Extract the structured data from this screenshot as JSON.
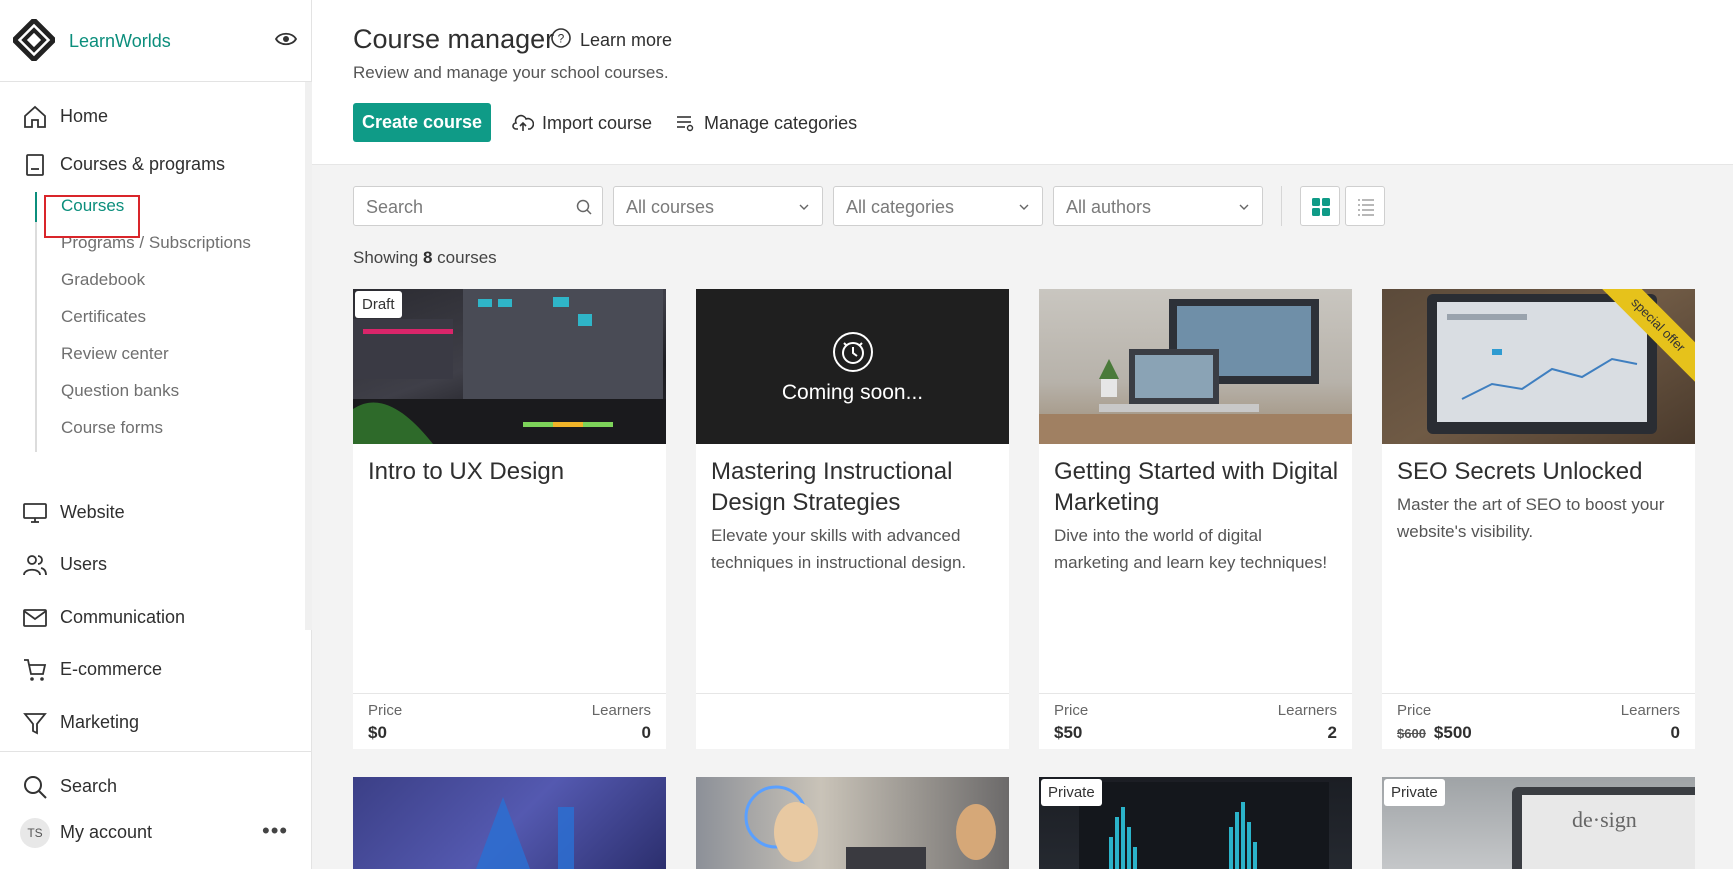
{
  "sidebar": {
    "brand": "LearnWorlds",
    "items": [
      {
        "label": "Home"
      },
      {
        "label": "Courses & programs"
      },
      {
        "label": "Website"
      },
      {
        "label": "Users"
      },
      {
        "label": "Communication"
      },
      {
        "label": "E-commerce"
      },
      {
        "label": "Marketing"
      }
    ],
    "subitems": [
      {
        "label": "Courses"
      },
      {
        "label": "Programs / Subscriptions"
      },
      {
        "label": "Gradebook"
      },
      {
        "label": "Certificates"
      },
      {
        "label": "Review center"
      },
      {
        "label": "Question banks"
      },
      {
        "label": "Course forms"
      }
    ],
    "footer": {
      "search": "Search",
      "account": "My account",
      "avatar_initials": "TS"
    }
  },
  "header": {
    "title": "Course manager",
    "learn_more": "Learn more",
    "subtitle": "Review and manage your school courses.",
    "create_course": "Create course",
    "import_course": "Import course",
    "manage_categories": "Manage categories"
  },
  "filters": {
    "search_placeholder": "Search",
    "courses": "All courses",
    "categories": "All categories",
    "authors": "All authors"
  },
  "summary": {
    "prefix": "Showing",
    "count": "8",
    "suffix": "courses"
  },
  "labels": {
    "price": "Price",
    "learners": "Learners"
  },
  "cards": [
    {
      "title": "Intro to UX Design",
      "desc": "",
      "badge": "Draft",
      "price": "$0",
      "learners": "0"
    },
    {
      "title": "Mastering Instructional Design Strategies",
      "desc": "Elevate your skills with advanced techniques in instructional design.",
      "overlay": "Coming soon..."
    },
    {
      "title": "Getting Started with Digital Marketing",
      "desc": "Dive into the world of digital marketing and learn key techniques!",
      "price": "$50",
      "learners": "2"
    },
    {
      "title": "SEO Secrets Unlocked",
      "desc": "Master the art of SEO to boost your website's visibility.",
      "ribbon": "special offer",
      "old_price": "$600",
      "price": "$500",
      "learners": "0"
    },
    {
      "title": "",
      "badge": ""
    },
    {
      "title": "",
      "badge": ""
    },
    {
      "title": "",
      "badge": "Private"
    },
    {
      "title": "",
      "badge": "Private"
    }
  ],
  "colors": {
    "accent": "#0f9b87",
    "highlight": "#d9252a"
  }
}
